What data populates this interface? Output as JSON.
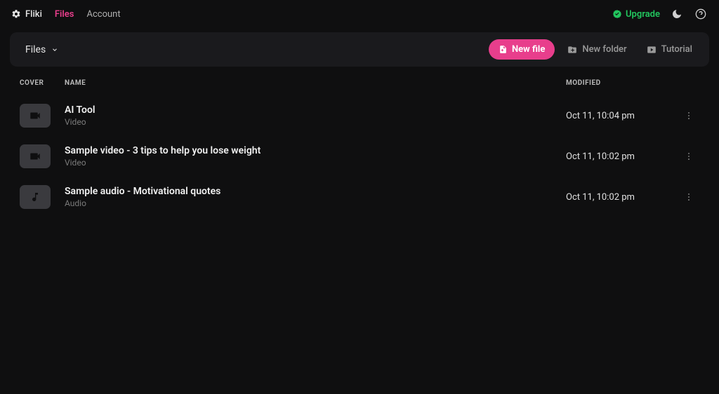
{
  "brand": "Fliki",
  "nav": {
    "files": "Files",
    "account": "Account"
  },
  "header": {
    "upgrade": "Upgrade"
  },
  "toolbar": {
    "folder_label": "Files",
    "new_file": "New file",
    "new_folder": "New folder",
    "tutorial": "Tutorial"
  },
  "columns": {
    "cover": "COVER",
    "name": "NAME",
    "modified": "MODIFIED"
  },
  "files": [
    {
      "title": "AI Tool",
      "type": "Video",
      "modified": "Oct 11, 10:04 pm",
      "kind": "video"
    },
    {
      "title": "Sample video - 3 tips to help you lose weight",
      "type": "Video",
      "modified": "Oct 11, 10:02 pm",
      "kind": "video"
    },
    {
      "title": "Sample audio - Motivational quotes",
      "type": "Audio",
      "modified": "Oct 11, 10:02 pm",
      "kind": "audio"
    }
  ]
}
